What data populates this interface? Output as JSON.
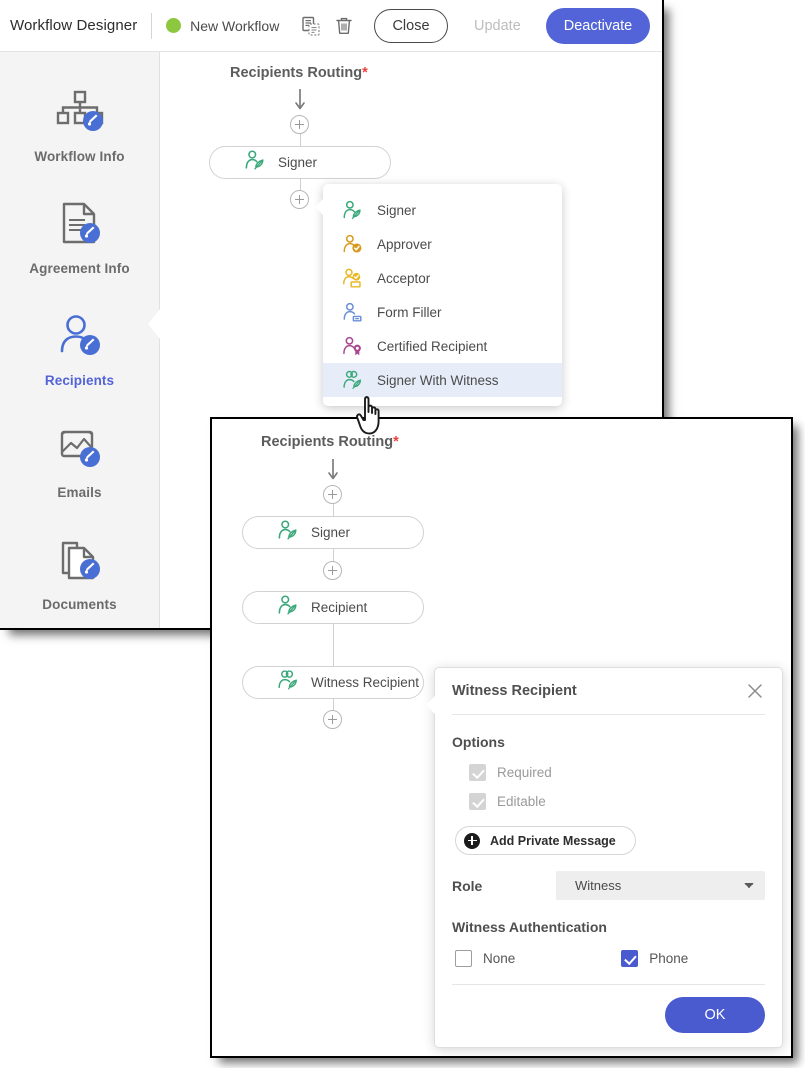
{
  "toolbar": {
    "app_title": "Workflow Designer",
    "status_dot_color": "#8dc63f",
    "workflow_name": "New Workflow",
    "copy_icon": "copy-document-icon",
    "delete_icon": "trash-icon",
    "close_label": "Close",
    "update_label": "Update",
    "deactivate_label": "Deactivate",
    "primary_color": "#5264d8"
  },
  "sidebar": {
    "items": [
      {
        "label": "Workflow Info",
        "icon": "workflow-hierarchy-edit-icon",
        "active": false
      },
      {
        "label": "Agreement Info",
        "icon": "document-edit-icon",
        "active": false
      },
      {
        "label": "Recipients",
        "icon": "person-edit-icon",
        "active": true
      },
      {
        "label": "Emails",
        "icon": "image-mail-edit-icon",
        "active": false
      },
      {
        "label": "Documents",
        "icon": "documents-edit-icon",
        "active": false
      }
    ],
    "active_color": "#5264d8",
    "inactive_color": "#6b6b6b"
  },
  "back_canvas": {
    "routing_title": "Recipients Routing",
    "required_marker": "*",
    "nodes": [
      {
        "label": "Signer",
        "icon": "signer-icon"
      }
    ],
    "add_node_icon": "plus-circle-icon",
    "flow_arrow_icon": "arrow-down-icon"
  },
  "recipient_menu": {
    "items": [
      {
        "label": "Signer",
        "icon": "signer-icon",
        "color": "#3aa87a",
        "highlighted": false
      },
      {
        "label": "Approver",
        "icon": "approver-icon",
        "color": "#d79a1e",
        "highlighted": false
      },
      {
        "label": "Acceptor",
        "icon": "acceptor-icon",
        "color": "#e8b823",
        "highlighted": false
      },
      {
        "label": "Form Filler",
        "icon": "form-filler-icon",
        "color": "#6a8fd8",
        "highlighted": false
      },
      {
        "label": "Certified Recipient",
        "icon": "certified-recipient-icon",
        "color": "#a8478f",
        "highlighted": false
      },
      {
        "label": "Signer With Witness",
        "icon": "signer-with-witness-icon",
        "color": "#3aa87a",
        "highlighted": true
      }
    ],
    "highlight_color": "#e6ecf8"
  },
  "front_canvas": {
    "routing_title": "Recipients Routing",
    "required_marker": "*",
    "nodes": [
      {
        "label": "Signer",
        "icon": "signer-icon"
      },
      {
        "label": "Recipient",
        "icon": "signer-icon"
      },
      {
        "label": "Witness Recipient",
        "icon": "signer-with-witness-icon"
      }
    ],
    "add_node_icon": "plus-circle-icon",
    "flow_arrow_icon": "arrow-down-icon"
  },
  "dialog": {
    "title": "Witness Recipient",
    "close_icon": "close-x-icon",
    "options_heading": "Options",
    "options": [
      {
        "label": "Required",
        "checked": true,
        "disabled": true
      },
      {
        "label": "Editable",
        "checked": true,
        "disabled": true
      }
    ],
    "add_private_message_label": "Add Private Message",
    "add_private_message_icon": "plus-circle-filled-icon",
    "role_label": "Role",
    "role_value": "Witness",
    "role_options": [
      "Witness"
    ],
    "role_dropdown_icon": "chevron-down-icon",
    "auth_heading": "Witness Authentication",
    "auth_options": [
      {
        "label": "None",
        "checked": false
      },
      {
        "label": "Phone",
        "checked": true
      }
    ],
    "ok_label": "OK",
    "ok_color": "#4a5bd0",
    "checked_color": "#4a5bd0",
    "disabled_check_color": "#d4d4d4"
  },
  "cursor": {
    "icon": "pointing-hand-cursor-icon"
  }
}
